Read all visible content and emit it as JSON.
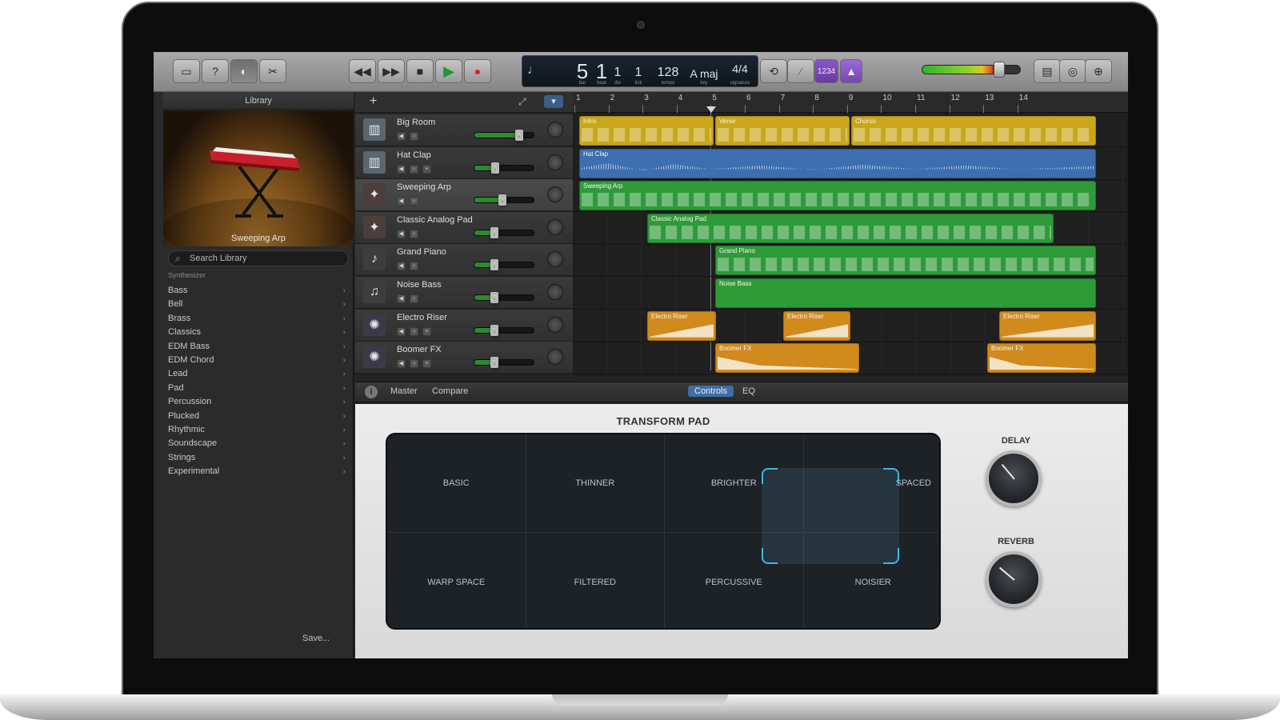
{
  "toolbar": {
    "buttons": [
      "library-toggle",
      "help",
      "smart-controls",
      "editors"
    ],
    "transport": [
      "rewind",
      "fast-forward",
      "stop",
      "play",
      "record"
    ],
    "lcd": {
      "bar": "5",
      "beat": "1",
      "division": "1",
      "tick": "1",
      "tempo": "128",
      "key": "A maj",
      "time_sig": "4/4",
      "bar_label": "bar",
      "beat_label": "beat",
      "div_label": "div",
      "tick_label": "tick",
      "tempo_label": "tempo",
      "key_label": "key",
      "sig_label": "signature"
    },
    "count_in": "1234",
    "master_volume": 0.72
  },
  "library": {
    "title": "Library",
    "patch_name": "Sweeping Arp",
    "search_placeholder": "Search Library",
    "path": "Synthesizer",
    "categories": [
      "Bass",
      "Bell",
      "Brass",
      "Classics",
      "EDM Bass",
      "EDM Chord",
      "Lead",
      "Pad",
      "Percussion",
      "Plucked",
      "Rhythmic",
      "Soundscape",
      "Strings",
      "Experimental"
    ],
    "save_label": "Save..."
  },
  "tracks": [
    {
      "name": "Big Room",
      "volume": 0.78
    },
    {
      "name": "Hat Clap",
      "volume": 0.32
    },
    {
      "name": "Sweeping Arp",
      "volume": 0.45
    },
    {
      "name": "Classic Analog Pad",
      "volume": 0.3
    },
    {
      "name": "Grand Piano",
      "volume": 0.3
    },
    {
      "name": "Noise Bass",
      "volume": 0.3
    },
    {
      "name": "Electro Riser",
      "volume": 0.3
    },
    {
      "name": "Boomer FX",
      "volume": 0.3
    }
  ],
  "ruler": [
    "1",
    "2",
    "3",
    "4",
    "5",
    "6",
    "7",
    "8",
    "9",
    "10",
    "11",
    "12",
    "13",
    "14"
  ],
  "regions": {
    "intro": "Intro",
    "verse": "Verse",
    "chorus": "Chorus",
    "hat_clap": "Hat Clap",
    "sweeping_arp": "Sweeping Arp",
    "classic_analog_pad": "Classic Analog Pad",
    "grand_piano": "Grand Piano",
    "noise_bass": "Noise Bass",
    "electro_riser": "Electro Riser",
    "boomer_fx": "Boomer FX"
  },
  "smart_controls": {
    "tabs": [
      "Master",
      "Compare"
    ],
    "view_tabs": [
      "Controls",
      "EQ"
    ],
    "pad_title": "TRANSFORM PAD",
    "pad_cells": [
      "BASIC",
      "THINNER",
      "BRIGHTER",
      "SPACED",
      "WARP SPACE",
      "FILTERED",
      "PERCUSSIVE",
      "NOISIER"
    ],
    "delay_label": "DELAY",
    "reverb_label": "REVERB"
  },
  "colors": {
    "yellow_region": "#c9a61c",
    "blue_region": "#3d6fb0",
    "green_region": "#2e9b38",
    "orange_region": "#d18a1c",
    "pad_highlight": "#3ab8e6"
  }
}
